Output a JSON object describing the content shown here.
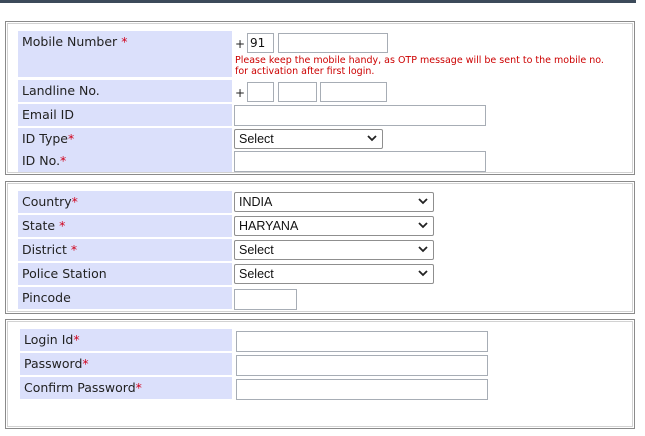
{
  "contact": {
    "mobile_label": "Mobile Number",
    "mobile_req": "*",
    "country_code_plus": "+",
    "country_code": "91",
    "mobile_note_line1": "Please keep the mobile handy, as OTP message will be sent to the mobile no.",
    "mobile_note_line2": "for activation after first login.",
    "landline_label": "Landline No.",
    "landline_plus": "+",
    "email_label": "Email ID",
    "id_type_label": "ID Type",
    "id_type_req": "*",
    "id_type_value": "Select",
    "id_no_label": "ID No.",
    "id_no_req": "*"
  },
  "address": {
    "country_label": "Country",
    "country_req": "*",
    "country_value": "INDIA",
    "state_label": "State",
    "state_req": "*",
    "state_value": "HARYANA",
    "district_label": "District",
    "district_req": "*",
    "district_value": "Select",
    "police_label": "Police Station",
    "police_value": "Select",
    "pincode_label": "Pincode"
  },
  "login": {
    "login_id_label": "Login Id",
    "login_id_req": "*",
    "password_label": "Password",
    "password_req": "*",
    "confirm_label": "Confirm Password",
    "confirm_req": "*"
  },
  "colors": {
    "label_bg": "#dbe0fb",
    "required": "#d0021b",
    "note": "#cc0000"
  }
}
